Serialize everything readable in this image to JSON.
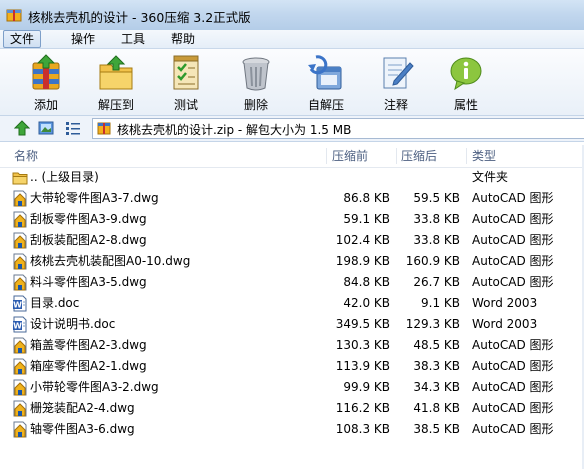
{
  "window": {
    "title": "核桃去壳机的设计 - 360压缩 3.2正式版"
  },
  "menu": {
    "items": [
      {
        "id": "file",
        "label": "文件"
      },
      {
        "id": "operate",
        "label": "操作"
      },
      {
        "id": "tools",
        "label": "工具"
      },
      {
        "id": "help",
        "label": "帮助"
      }
    ]
  },
  "toolbar": {
    "items": [
      {
        "id": "add",
        "label": "添加",
        "icon": "add-archive-icon"
      },
      {
        "id": "extract",
        "label": "解压到",
        "icon": "extract-folder-icon"
      },
      {
        "id": "test",
        "label": "测试",
        "icon": "checklist-icon"
      },
      {
        "id": "delete",
        "label": "删除",
        "icon": "trash-can-icon"
      },
      {
        "id": "selfextract",
        "label": "自解压",
        "icon": "self-extract-icon"
      },
      {
        "id": "comment",
        "label": "注释",
        "icon": "comment-pencil-icon"
      },
      {
        "id": "properties",
        "label": "属性",
        "icon": "info-icon"
      }
    ]
  },
  "address": {
    "path": "核桃去壳机的设计.zip - 解包大小为 1.5 MB"
  },
  "columns": {
    "name": "名称",
    "size": "压缩前",
    "packed": "压缩后",
    "type": "类型"
  },
  "files": [
    {
      "name": ".. (上级目录)",
      "size": "",
      "packed": "",
      "type": "文件夹",
      "icon": "folder-icon"
    },
    {
      "name": "大带轮零件图A3-7.dwg",
      "size": "86.8 KB",
      "packed": "59.5 KB",
      "type": "AutoCAD 图形",
      "icon": "dwg-file-icon"
    },
    {
      "name": "刮板零件图A3-9.dwg",
      "size": "59.1 KB",
      "packed": "33.8 KB",
      "type": "AutoCAD 图形",
      "icon": "dwg-file-icon"
    },
    {
      "name": "刮板装配图A2-8.dwg",
      "size": "102.4 KB",
      "packed": "33.8 KB",
      "type": "AutoCAD 图形",
      "icon": "dwg-file-icon"
    },
    {
      "name": "核桃去壳机装配图A0-10.dwg",
      "size": "198.9 KB",
      "packed": "160.9 KB",
      "type": "AutoCAD 图形",
      "icon": "dwg-file-icon"
    },
    {
      "name": "料斗零件图A3-5.dwg",
      "size": "84.8 KB",
      "packed": "26.7 KB",
      "type": "AutoCAD 图形",
      "icon": "dwg-file-icon"
    },
    {
      "name": "目录.doc",
      "size": "42.0 KB",
      "packed": "9.1 KB",
      "type": "Word 2003",
      "icon": "word-doc-icon"
    },
    {
      "name": "设计说明书.doc",
      "size": "349.5 KB",
      "packed": "129.3 KB",
      "type": "Word 2003",
      "icon": "word-doc-icon"
    },
    {
      "name": "箱盖零件图A2-3.dwg",
      "size": "130.3 KB",
      "packed": "48.5 KB",
      "type": "AutoCAD 图形",
      "icon": "dwg-file-icon"
    },
    {
      "name": "箱座零件图A2-1.dwg",
      "size": "113.9 KB",
      "packed": "38.3 KB",
      "type": "AutoCAD 图形",
      "icon": "dwg-file-icon"
    },
    {
      "name": "小带轮零件图A3-2.dwg",
      "size": "99.9 KB",
      "packed": "34.3 KB",
      "type": "AutoCAD 图形",
      "icon": "dwg-file-icon"
    },
    {
      "name": "栅笼装配A2-4.dwg",
      "size": "116.2 KB",
      "packed": "41.8 KB",
      "type": "AutoCAD 图形",
      "icon": "dwg-file-icon"
    },
    {
      "name": "轴零件图A3-6.dwg",
      "size": "108.3 KB",
      "packed": "38.5 KB",
      "type": "AutoCAD 图形",
      "icon": "dwg-file-icon"
    }
  ],
  "colors": {
    "titlebar": "#c2d7ee",
    "header_text": "#4d6082",
    "menu_active_border": "#7d9fc9"
  }
}
